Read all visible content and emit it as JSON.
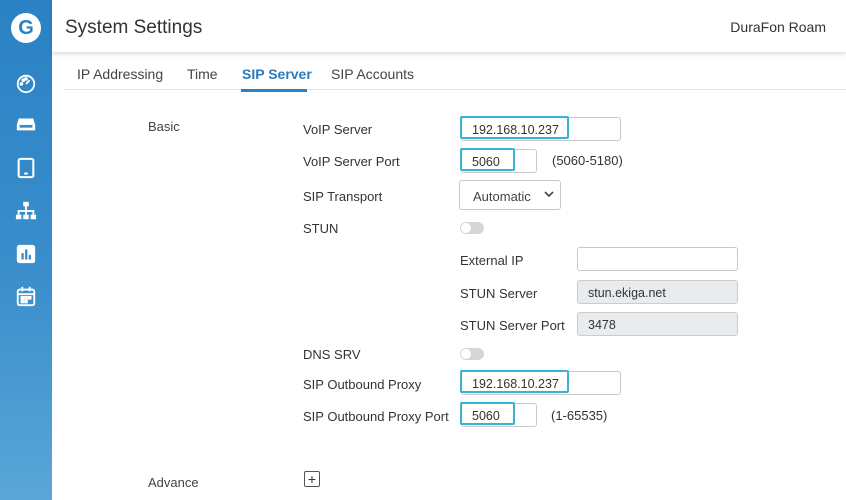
{
  "app": {
    "logo_text": "G",
    "title": "System Settings",
    "device": "DuraFon Roam"
  },
  "sidebar": {
    "icons": [
      "dashboard-icon",
      "inbox-icon",
      "tablet-icon",
      "network-icon",
      "chart-icon",
      "calendar-icon"
    ]
  },
  "tabs": [
    {
      "label": "IP Addressing"
    },
    {
      "label": "Time"
    },
    {
      "label": "SIP Server",
      "active": true
    },
    {
      "label": "SIP Accounts"
    }
  ],
  "sections": {
    "basic": "Basic",
    "advance": "Advance",
    "advance_expand": "+"
  },
  "fields": {
    "voip_server": {
      "label": "VoIP Server",
      "value": "192.168.10.237"
    },
    "voip_server_port": {
      "label": "VoIP Server Port",
      "value": "5060",
      "hint": "(5060-5180)"
    },
    "sip_transport": {
      "label": "SIP Transport",
      "value": "Automatic"
    },
    "stun": {
      "label": "STUN",
      "enabled": false
    },
    "external_ip": {
      "label": "External IP",
      "value": ""
    },
    "stun_server": {
      "label": "STUN Server",
      "value": "stun.ekiga.net"
    },
    "stun_server_port": {
      "label": "STUN Server Port",
      "value": "3478"
    },
    "dns_srv": {
      "label": "DNS SRV",
      "enabled": false
    },
    "sip_outbound_proxy": {
      "label": "SIP Outbound Proxy",
      "value": "192.168.10.237"
    },
    "sip_outbound_proxy_port": {
      "label": "SIP Outbound Proxy Port",
      "value": "5060",
      "hint": "(1-65535)"
    }
  },
  "colors": {
    "accent": "#2a82c4",
    "highlight": "#34b5d5"
  }
}
